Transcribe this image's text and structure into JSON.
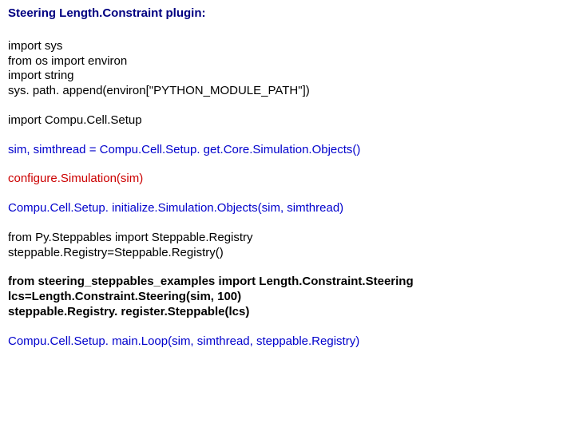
{
  "title": "Steering Length.Constraint plugin:",
  "block1": {
    "l1": "import sys",
    "l2": "from os import environ",
    "l3": "import string",
    "l4": "sys. path. append(environ[\"PYTHON_MODULE_PATH\"])"
  },
  "block2": "import Compu.Cell.Setup",
  "block3": "sim, simthread = Compu.Cell.Setup. get.Core.Simulation.Objects()",
  "block4": "configure.Simulation(sim)",
  "block5": "Compu.Cell.Setup. initialize.Simulation.Objects(sim, simthread)",
  "block6": {
    "l1": "from Py.Steppables import Steppable.Registry",
    "l2": "steppable.Registry=Steppable.Registry()"
  },
  "block7": {
    "l1": "from steering_steppables_examples import Length.Constraint.Steering",
    "l2": "lcs=Length.Constraint.Steering(sim, 100)",
    "l3": "steppable.Registry. register.Steppable(lcs)"
  },
  "block8": "Compu.Cell.Setup. main.Loop(sim, simthread, steppable.Registry)"
}
